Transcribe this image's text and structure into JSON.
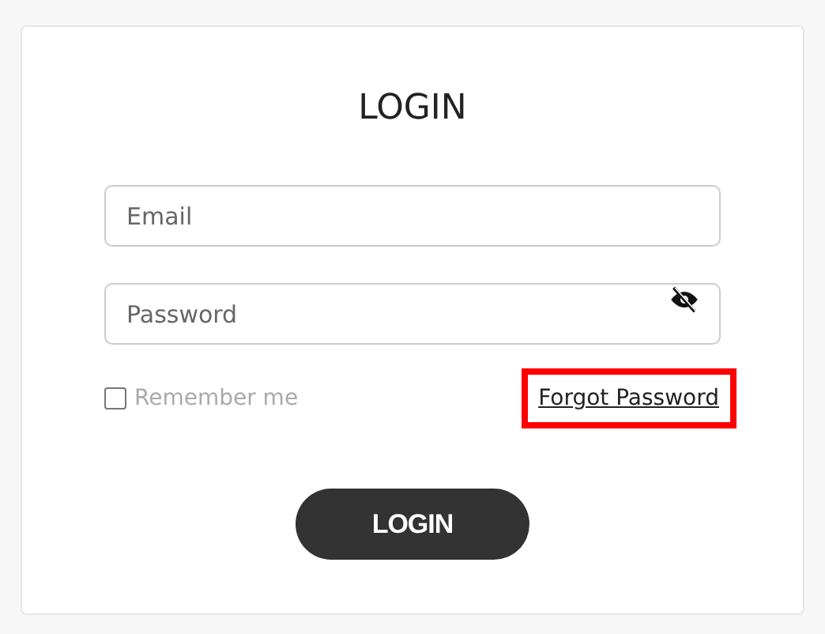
{
  "title": "LOGIN",
  "fields": [
    {
      "kind": "text",
      "placeholder": "Email"
    },
    {
      "kind": "password",
      "placeholder": "Password"
    }
  ],
  "remember": {
    "label": "Remember me",
    "checked": false
  },
  "forgot_link": {
    "label": "Forgot Password",
    "highlighted": true
  },
  "submit": {
    "label": "LOGIN"
  }
}
